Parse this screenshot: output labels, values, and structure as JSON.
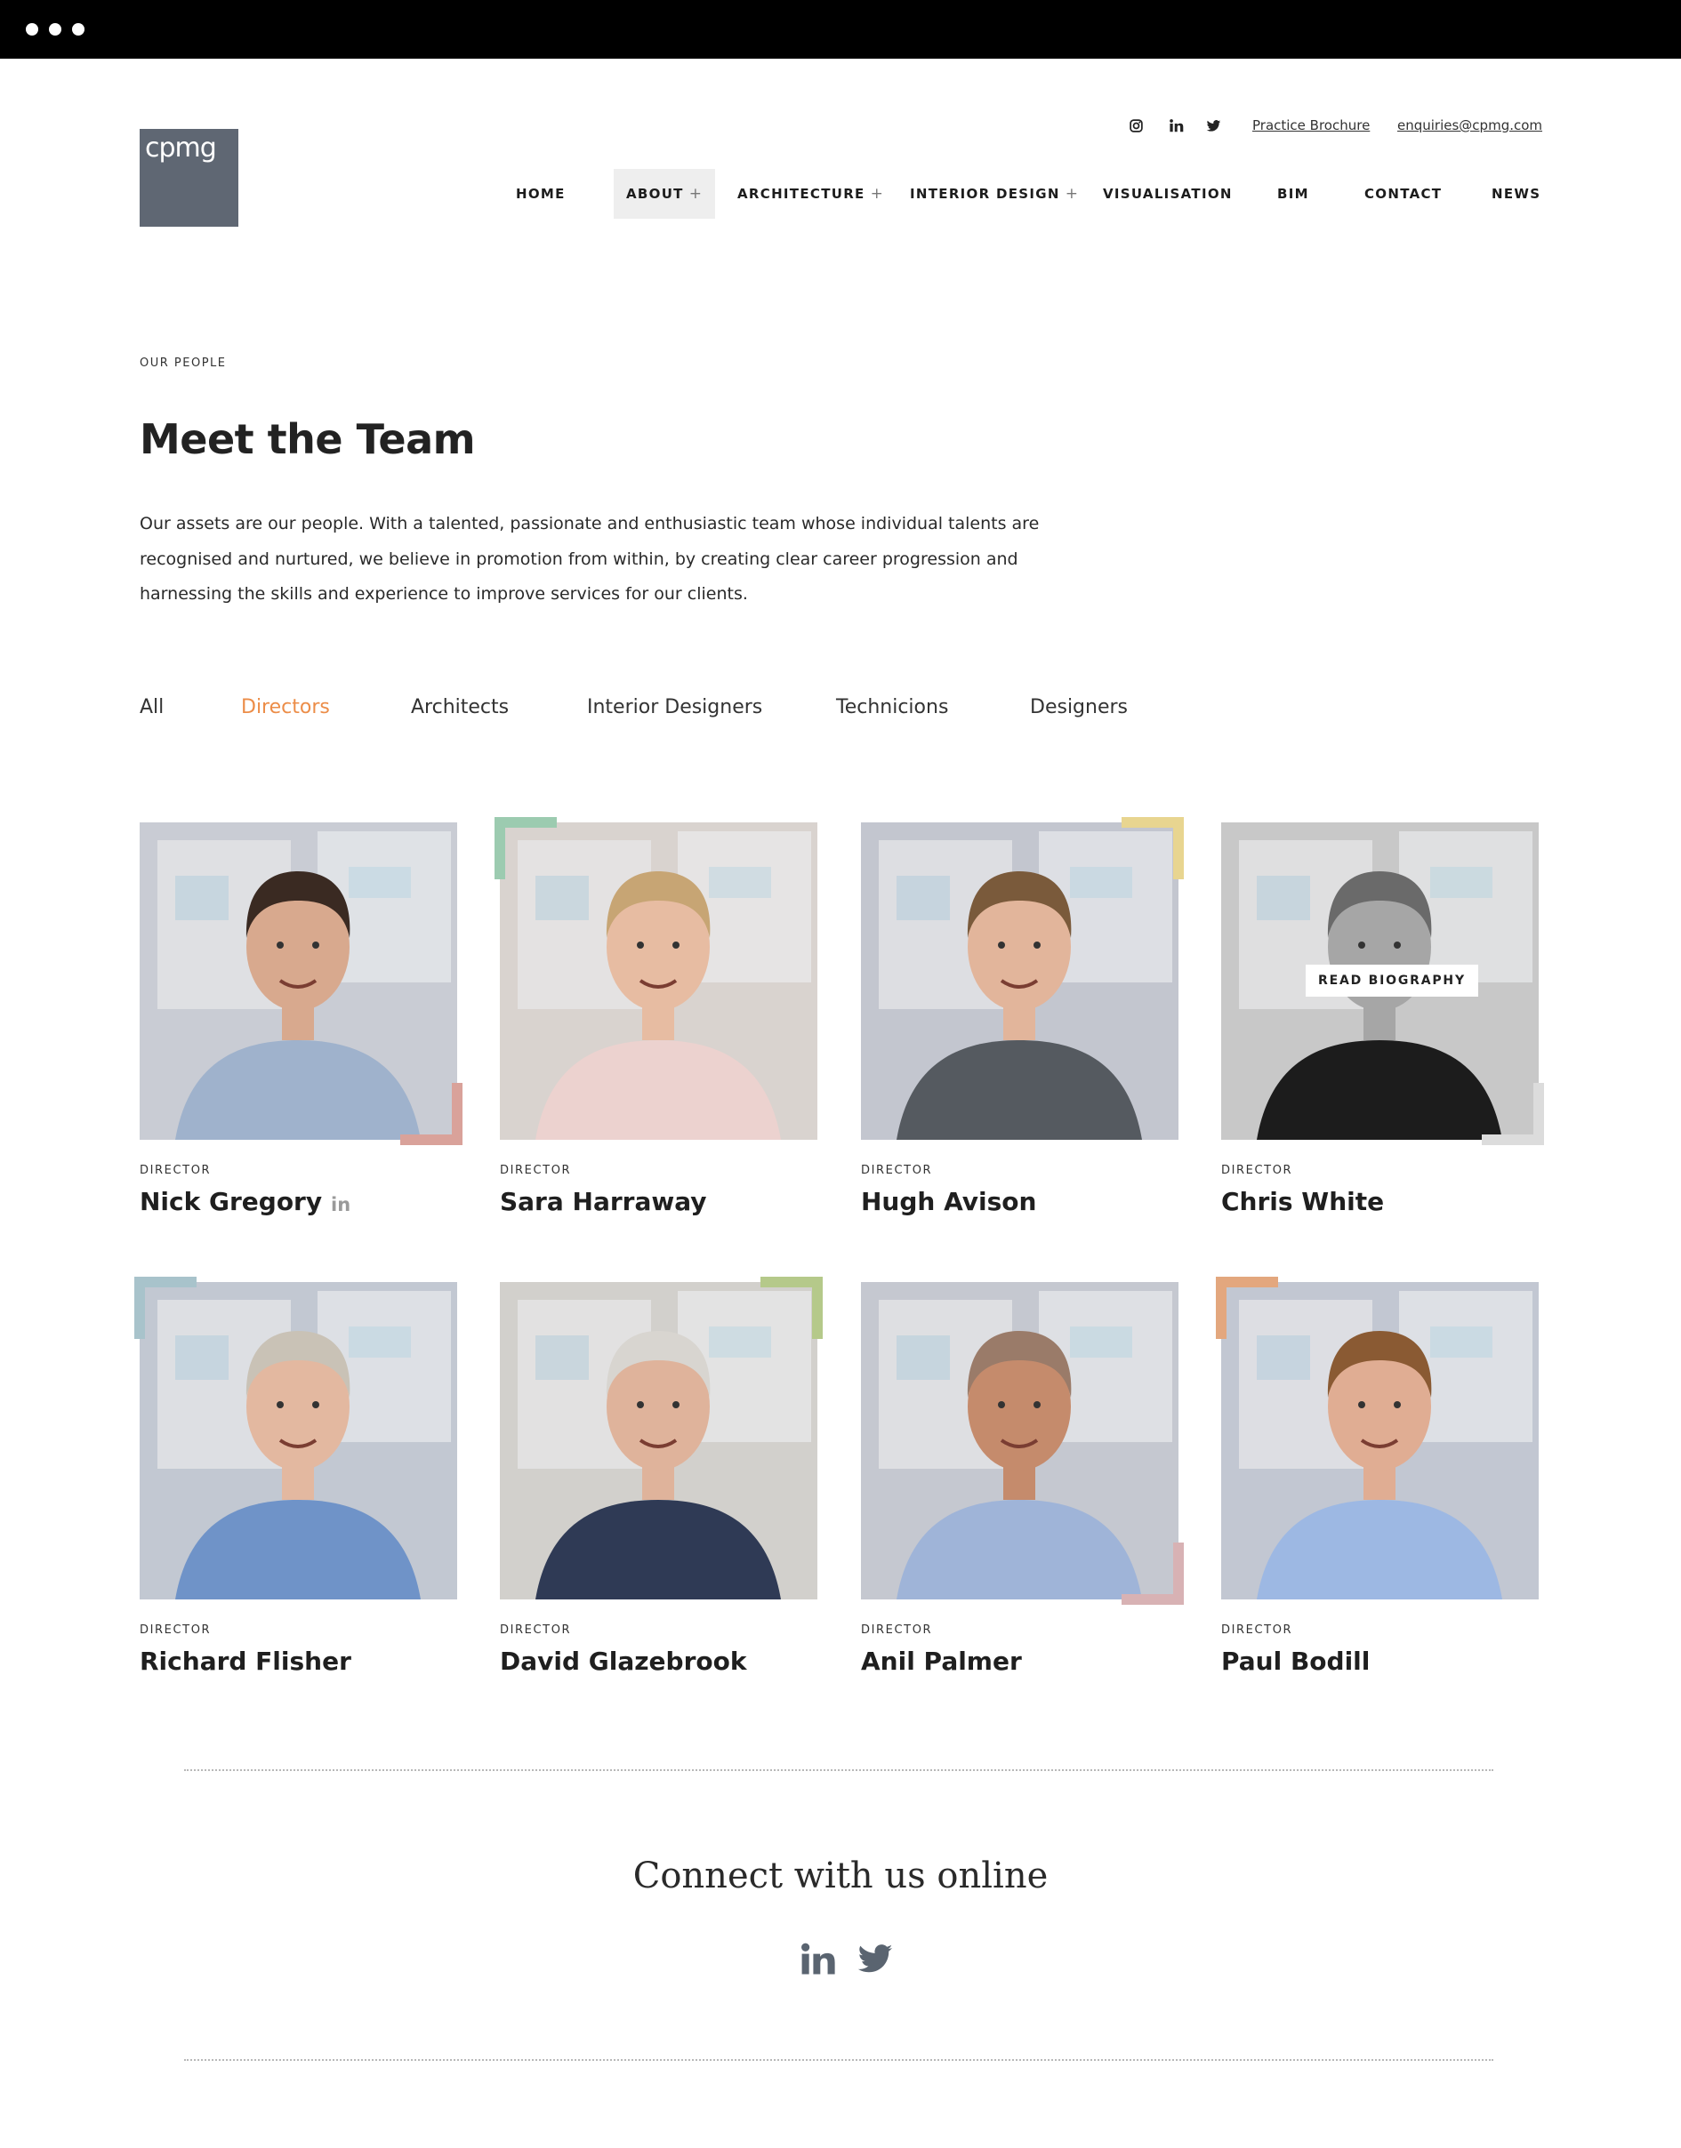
{
  "brand": {
    "logo_text": "cpmg",
    "logo_color": "#5f6773"
  },
  "utility": {
    "social_icons": [
      "instagram-icon",
      "linkedin-icon",
      "twitter-icon"
    ],
    "brochure_label": "Practice Brochure",
    "email_label": "enquiries@cpmg.com"
  },
  "nav": {
    "home": "HOME",
    "about": "ABOUT",
    "architecture": "ARCHITECTURE",
    "interior_design": "INTERIOR DESIGN",
    "visualisation": "VISUALISATION",
    "bim": "BIM",
    "contact": "CONTACT",
    "news": "NEWS",
    "plus": "+"
  },
  "header": {
    "eyebrow": "OUR PEOPLE",
    "title": "Meet the Team",
    "intro_lines": [
      "Our assets are our people. With a talented, passionate and enthusiastic team whose individual talents are",
      "recognised and nurtured, we believe in promotion from within, by creating clear career progression and",
      "harnessing the skills and experience to improve services for our clients."
    ]
  },
  "filters": {
    "all": "All",
    "directors": "Directors",
    "architects": "Architects",
    "interior_designers": "Interior Designers",
    "technicians": "Technicions",
    "designers": "Designers",
    "active": "Directors",
    "active_color": "#ec8d48"
  },
  "team": [
    {
      "role": "DIRECTOR",
      "name": "Nick Gregory",
      "linkedin": "in",
      "accent": "#d9a29a"
    },
    {
      "role": "DIRECTOR",
      "name": "Sara Harraway",
      "accent": "#9ccbb0"
    },
    {
      "role": "DIRECTOR",
      "name": "Hugh Avison",
      "accent": "#e8d590"
    },
    {
      "role": "DIRECTOR",
      "name": "Chris White",
      "accent": "#dcdcdc",
      "hover_label": "READ BIOGRAPHY"
    },
    {
      "role": "DIRECTOR",
      "name": "Richard Flisher",
      "accent": "#a8c3cb"
    },
    {
      "role": "DIRECTOR",
      "name": "David Glazebrook",
      "accent": "#b5c98a"
    },
    {
      "role": "DIRECTOR",
      "name": "Anil Palmer",
      "accent": "#d8b2b4"
    },
    {
      "role": "DIRECTOR",
      "name": "Paul Bodill",
      "accent": "#e3a77e"
    }
  ],
  "footer": {
    "connect_title": "Connect with us online",
    "social_icons": [
      "linkedin-icon",
      "twitter-icon"
    ]
  }
}
